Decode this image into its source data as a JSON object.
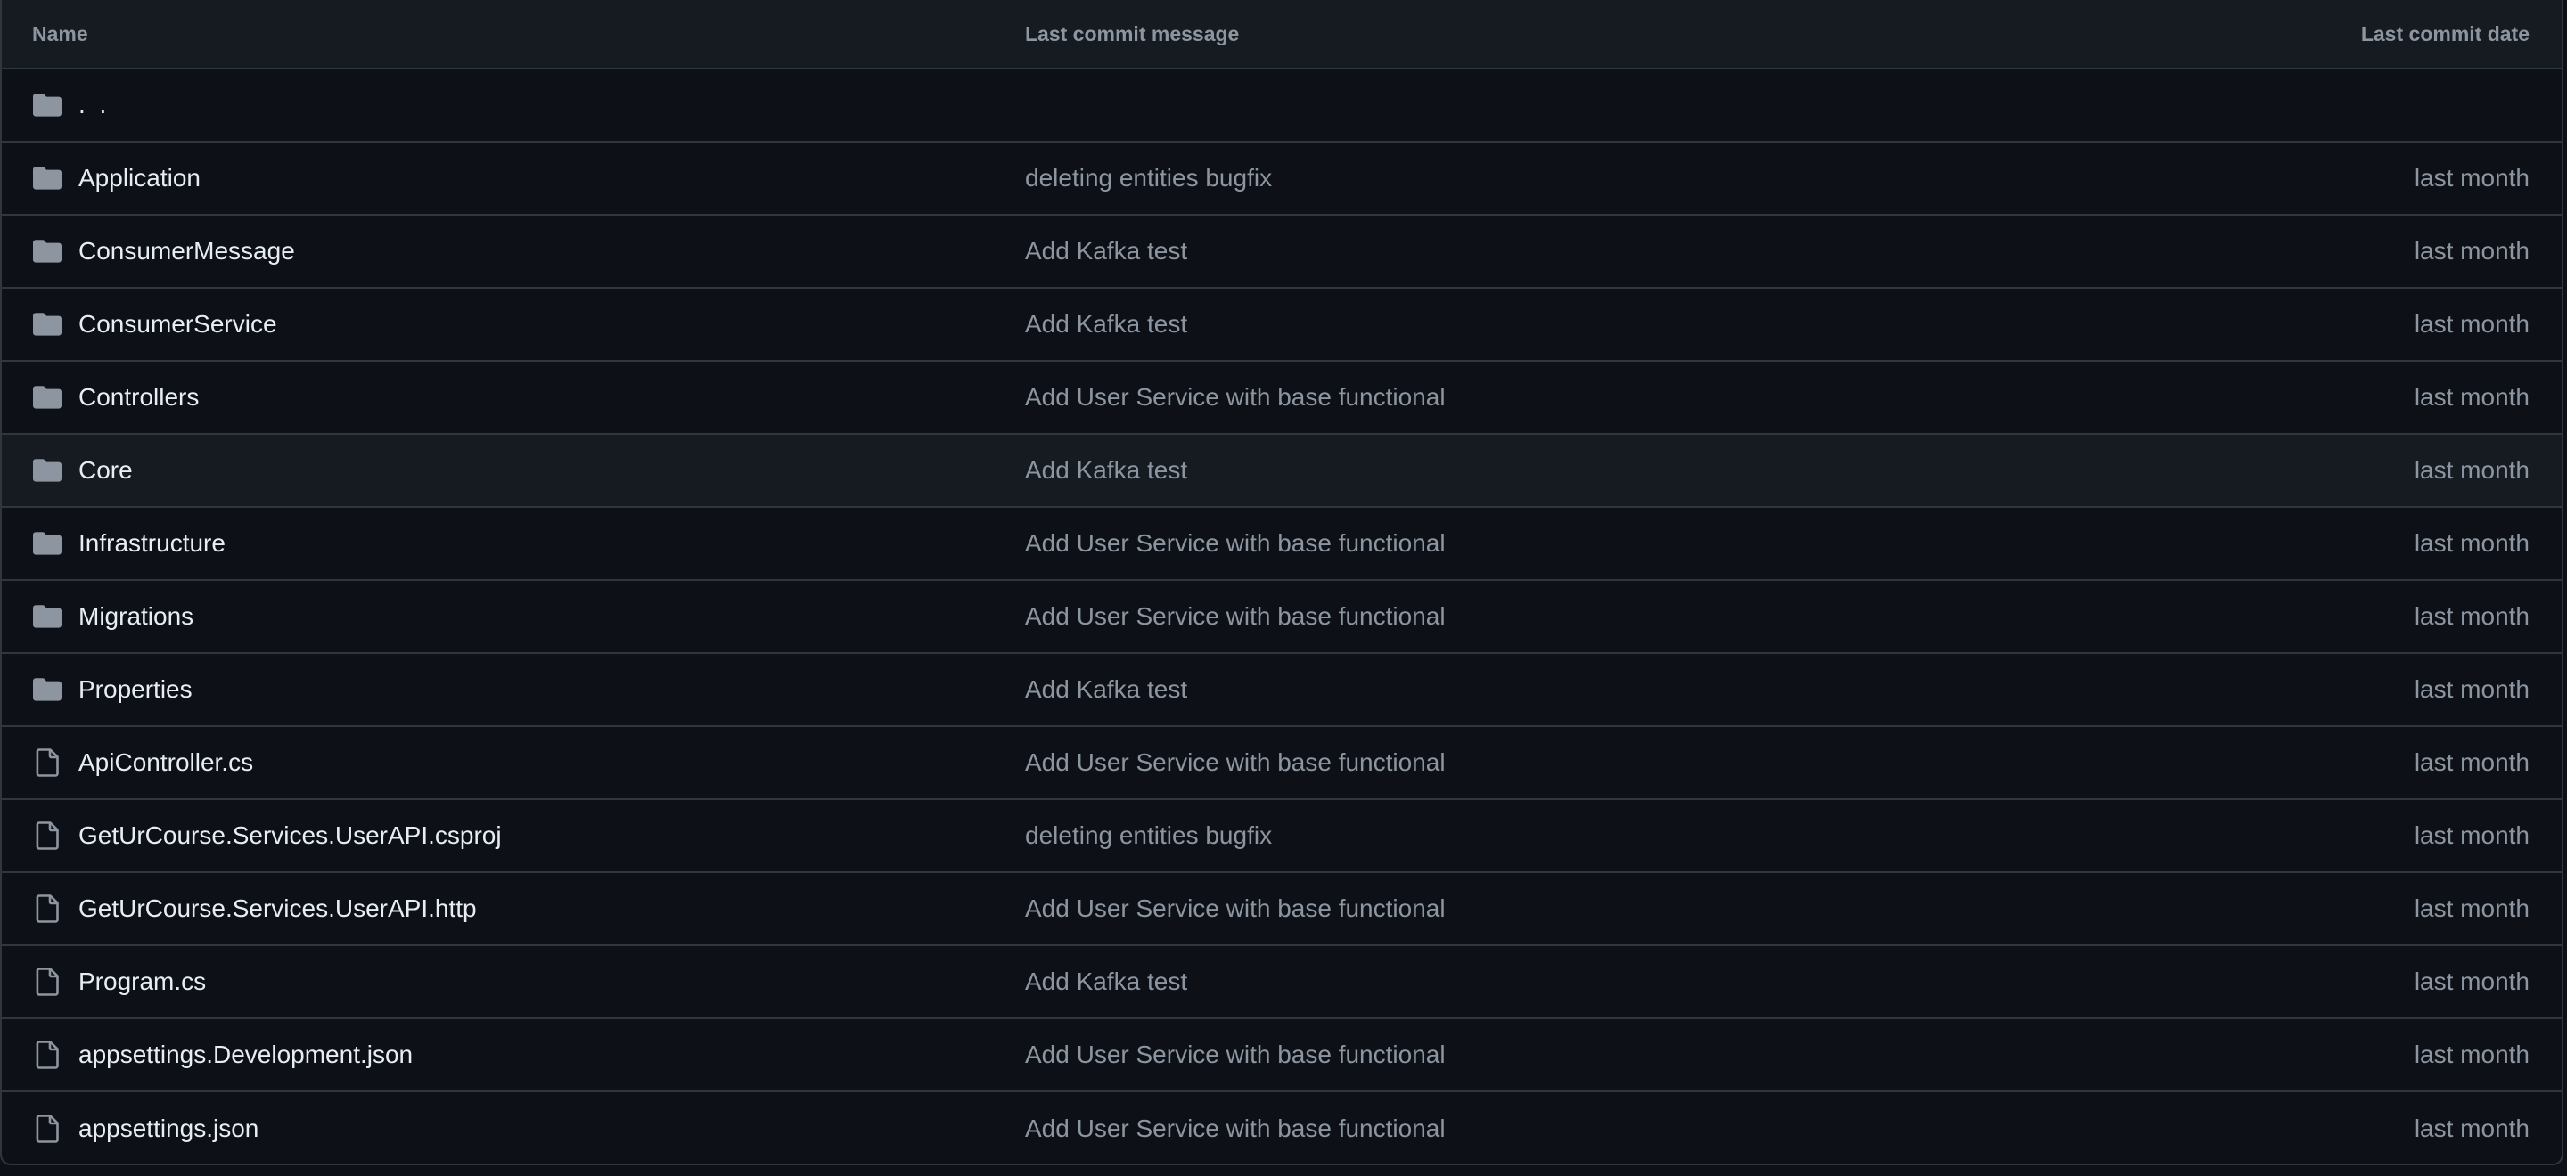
{
  "header": {
    "name": "Name",
    "message": "Last commit message",
    "date": "Last commit date"
  },
  "parent": {
    "label": ". .",
    "icon": "folder-icon"
  },
  "rows": [
    {
      "name": "Application",
      "type": "folder",
      "icon": "folder-icon",
      "message": "deleting entities bugfix",
      "date": "last month"
    },
    {
      "name": "ConsumerMessage",
      "type": "folder",
      "icon": "folder-icon",
      "message": "Add Kafka test",
      "date": "last month"
    },
    {
      "name": "ConsumerService",
      "type": "folder",
      "icon": "folder-icon",
      "message": "Add Kafka test",
      "date": "last month"
    },
    {
      "name": "Controllers",
      "type": "folder",
      "icon": "folder-icon",
      "message": "Add User Service with base functional",
      "date": "last month"
    },
    {
      "name": "Core",
      "type": "folder",
      "icon": "folder-icon",
      "message": "Add Kafka test",
      "date": "last month"
    },
    {
      "name": "Infrastructure",
      "type": "folder",
      "icon": "folder-icon",
      "message": "Add User Service with base functional",
      "date": "last month"
    },
    {
      "name": "Migrations",
      "type": "folder",
      "icon": "folder-icon",
      "message": "Add User Service with base functional",
      "date": "last month"
    },
    {
      "name": "Properties",
      "type": "folder",
      "icon": "folder-icon",
      "message": "Add Kafka test",
      "date": "last month"
    },
    {
      "name": "ApiController.cs",
      "type": "file",
      "icon": "file-icon",
      "message": "Add User Service with base functional",
      "date": "last month"
    },
    {
      "name": "GetUrCourse.Services.UserAPI.csproj",
      "type": "file",
      "icon": "file-icon",
      "message": "deleting entities bugfix",
      "date": "last month"
    },
    {
      "name": "GetUrCourse.Services.UserAPI.http",
      "type": "file",
      "icon": "file-icon",
      "message": "Add User Service with base functional",
      "date": "last month"
    },
    {
      "name": "Program.cs",
      "type": "file",
      "icon": "file-icon",
      "message": "Add Kafka test",
      "date": "last month"
    },
    {
      "name": "appsettings.Development.json",
      "type": "file",
      "icon": "file-icon",
      "message": "Add User Service with base functional",
      "date": "last month"
    },
    {
      "name": "appsettings.json",
      "type": "file",
      "icon": "file-icon",
      "message": "Add User Service with base functional",
      "date": "last month"
    }
  ],
  "colors": {
    "background": "#0d1117",
    "header_background": "#161b22",
    "border": "#30363d",
    "primary_text": "#e6edf3",
    "muted_text": "#8d96a0",
    "folder_icon": "#8d96a0"
  }
}
